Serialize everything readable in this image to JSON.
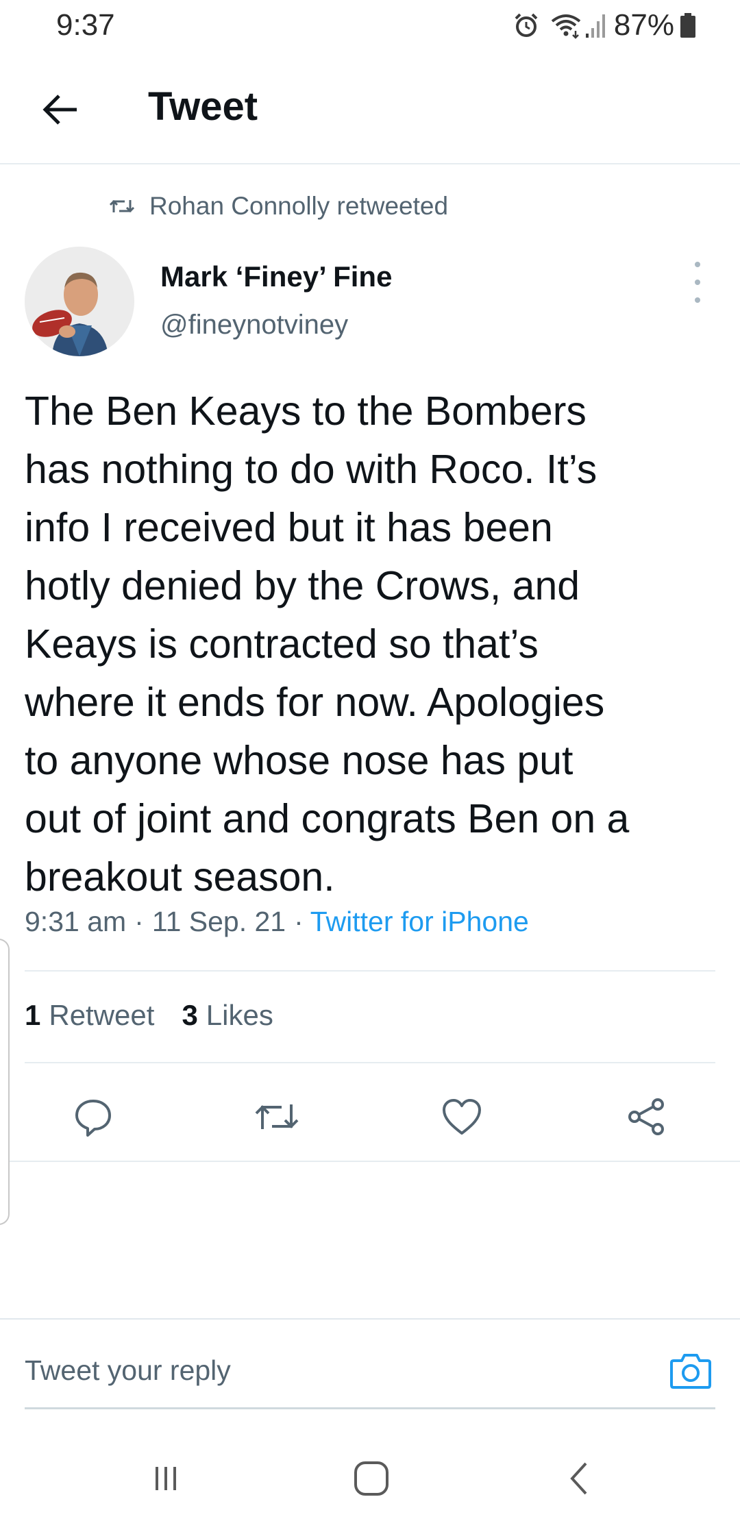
{
  "status_bar": {
    "time": "9:37",
    "battery": "87%",
    "icons": [
      "alarm-icon",
      "wifi-icon",
      "signal-icon",
      "battery-icon"
    ]
  },
  "header": {
    "title": "Tweet",
    "back_icon": "back-arrow-icon"
  },
  "tweet": {
    "retweet_context": "Rohan Connolly retweeted",
    "author_name": "Mark ‘Finey’ Fine",
    "author_handle": "@fineynotviney",
    "text": "The Ben Keays to the Bombers\nhas nothing to do with Roco.  It’s\ninfo I received but it has been\nhotly denied by the Crows, and\nKeays is contracted so that’s\nwhere it ends for now. Apologies\nto anyone whose nose has put\nout of joint and congrats Ben on a\nbreakout season.",
    "time": "9:31 am",
    "date": "11 Sep. 21",
    "separator": "·",
    "source": "Twitter for iPhone",
    "stats": {
      "retweets_count": "1",
      "retweets_label": "Retweet",
      "likes_count": "3",
      "likes_label": "Likes"
    },
    "actions": [
      "reply-icon",
      "retweet-icon",
      "like-icon",
      "share-icon"
    ]
  },
  "reply": {
    "placeholder": "Tweet your reply"
  },
  "colors": {
    "accent": "#1d9bf0",
    "secondary_text": "#536471",
    "divider": "#e6ecf0"
  }
}
